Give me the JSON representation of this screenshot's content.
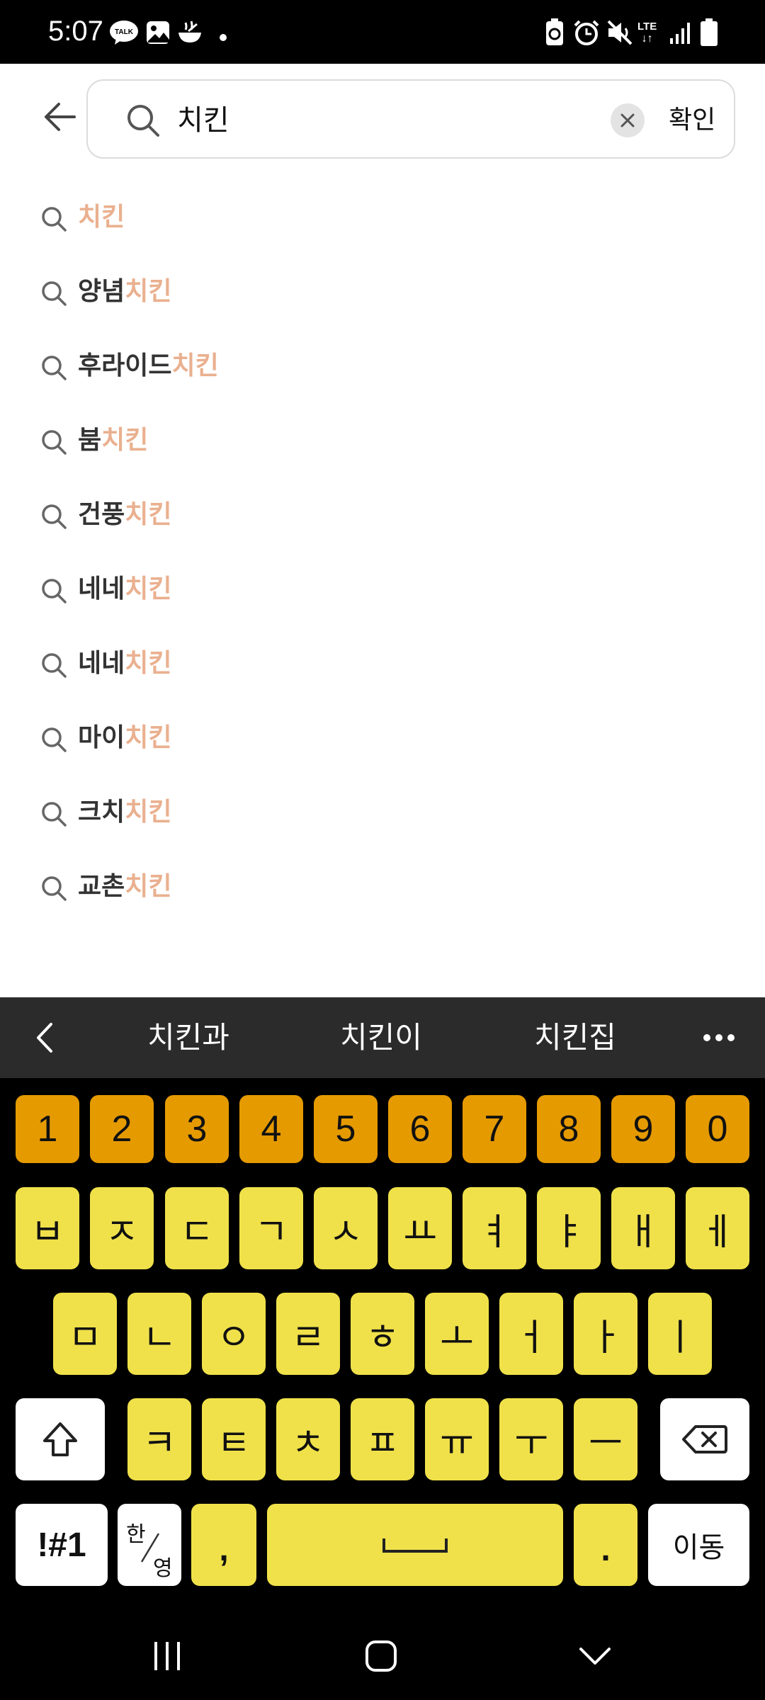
{
  "status_bar": {
    "time": "5:07",
    "icons": [
      "kakaotalk-icon",
      "gallery-icon",
      "food-icon",
      "recycle-icon",
      "alarm-icon",
      "mute-icon",
      "lte-icon",
      "signal-icon",
      "battery-icon"
    ],
    "lte_label": "LTE"
  },
  "search": {
    "query": "치킨",
    "confirm_label": "확인"
  },
  "suggestions": [
    {
      "prefix": "",
      "highlight": "치킨"
    },
    {
      "prefix": "양념",
      "highlight": "치킨"
    },
    {
      "prefix": "후라이드",
      "highlight": "치킨"
    },
    {
      "prefix": "붐",
      "highlight": "치킨"
    },
    {
      "prefix": "건풍",
      "highlight": "치킨"
    },
    {
      "prefix": "네네",
      "highlight": "치킨"
    },
    {
      "prefix": "네네",
      "highlight": "치킨"
    },
    {
      "prefix": "마이",
      "highlight": "치킨"
    },
    {
      "prefix": "크치",
      "highlight": "치킨"
    },
    {
      "prefix": "교촌",
      "highlight": "치킨"
    }
  ],
  "keyboard": {
    "predictions": [
      "치킨과",
      "치킨이",
      "치킨집"
    ],
    "number_row": [
      "1",
      "2",
      "3",
      "4",
      "5",
      "6",
      "7",
      "8",
      "9",
      "0"
    ],
    "row1": [
      "ㅂ",
      "ㅈ",
      "ㄷ",
      "ㄱ",
      "ㅅ",
      "ㅛ",
      "ㅕ",
      "ㅑ",
      "ㅐ",
      "ㅔ"
    ],
    "row2": [
      "ㅁ",
      "ㄴ",
      "ㅇ",
      "ㄹ",
      "ㅎ",
      "ㅗ",
      "ㅓ",
      "ㅏ",
      "ㅣ"
    ],
    "row3": [
      "ㅋ",
      "ㅌ",
      "ㅊ",
      "ㅍ",
      "ㅠ",
      "ㅜ",
      "ㅡ"
    ],
    "symbols_label": "!#1",
    "lang_top": "한",
    "lang_bottom": "영",
    "comma": ",",
    "period": ".",
    "enter_label": "이동"
  },
  "colors": {
    "highlight": "#eab08f",
    "number_key": "#e59a00",
    "letter_key": "#f0e14a",
    "suggestion_bar": "#2b2b2b"
  }
}
